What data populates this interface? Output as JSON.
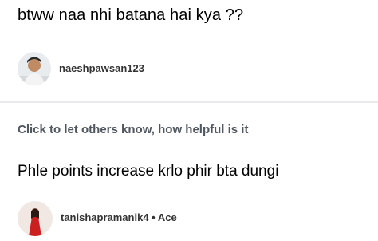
{
  "question": {
    "text": "btww naa nhi batana hai kya ??"
  },
  "asker": {
    "username": "naeshpawsan123"
  },
  "helpful_prompt": "Click to let others know, how helpful is it",
  "answer": {
    "text": "Phle points increase krlo phir bta dungi"
  },
  "answerer": {
    "username": "tanishapramanik4",
    "separator": "•",
    "rank": "Ace"
  },
  "colors": {
    "helpful_text": "#505760",
    "divider": "#e9e9ee"
  }
}
